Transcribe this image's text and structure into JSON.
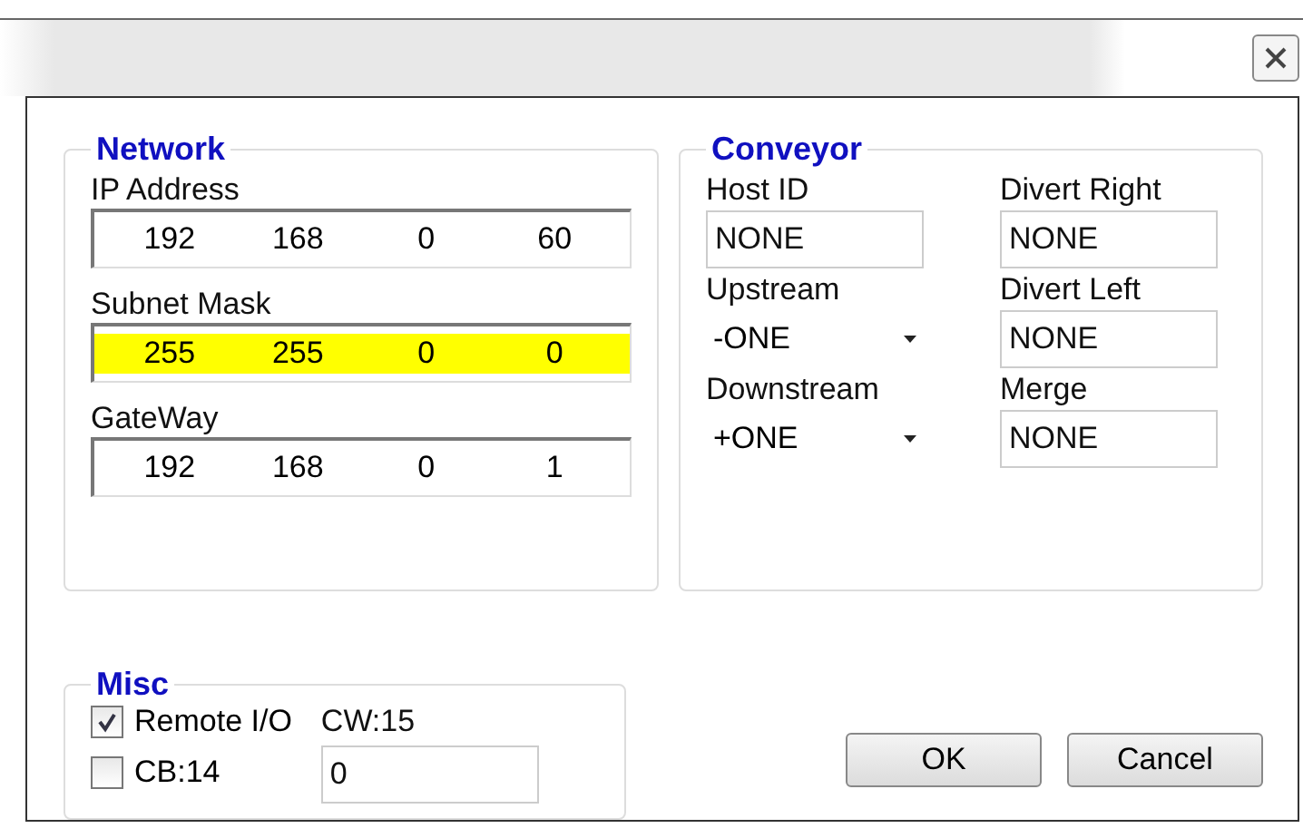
{
  "network": {
    "title": "Network",
    "fields": [
      {
        "label": "IP Address",
        "octets": [
          "192",
          "168",
          "0",
          "60"
        ],
        "highlighted": false
      },
      {
        "label": "Subnet Mask",
        "octets": [
          "255",
          "255",
          "0",
          "0"
        ],
        "highlighted": true
      },
      {
        "label": "GateWay",
        "octets": [
          "192",
          "168",
          "0",
          "1"
        ],
        "highlighted": false
      }
    ]
  },
  "conveyor": {
    "title": "Conveyor",
    "fields": [
      {
        "label": "Host ID",
        "value": "NONE",
        "kind": "text"
      },
      {
        "label": "Divert Right",
        "value": "NONE",
        "kind": "text"
      },
      {
        "label": "Upstream",
        "value": "-ONE",
        "kind": "dropdown"
      },
      {
        "label": "Divert Left",
        "value": "NONE",
        "kind": "text"
      },
      {
        "label": "Downstream",
        "value": "+ONE",
        "kind": "dropdown"
      },
      {
        "label": "Merge",
        "value": "NONE",
        "kind": "text"
      }
    ]
  },
  "misc": {
    "title": "Misc",
    "checkboxes": [
      {
        "label": "Remote I/O",
        "checked": true
      },
      {
        "label": "CB:14",
        "checked": false
      }
    ],
    "cw_label": "CW:15",
    "cw_value": "0"
  },
  "buttons": [
    "OK",
    "Cancel"
  ]
}
